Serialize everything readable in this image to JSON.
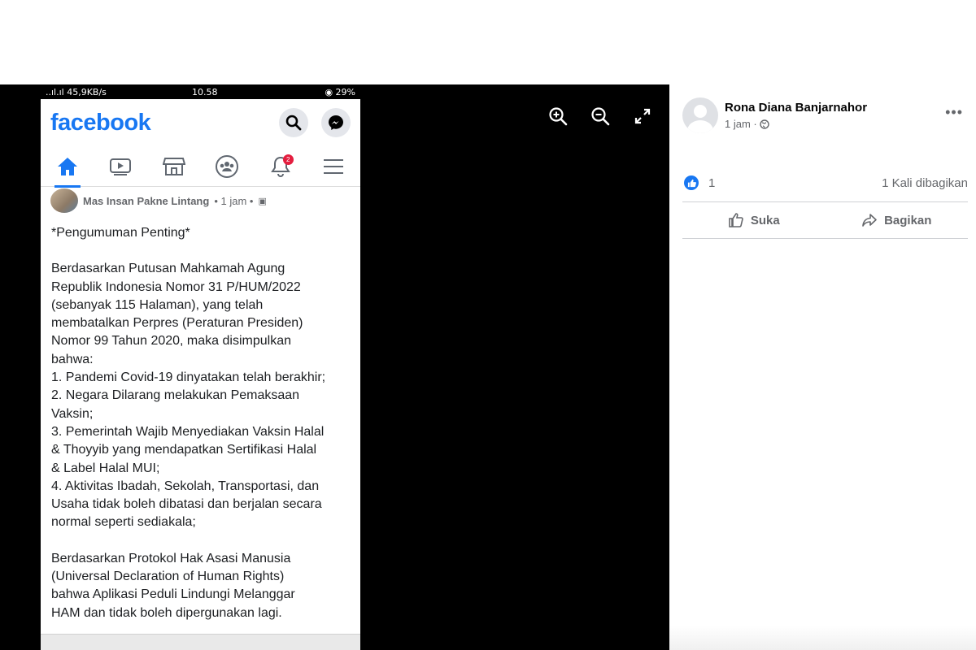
{
  "status_bar": {
    "signal": "..ıl.ıl 45,9KB/s",
    "time": "10.58",
    "battery": "29%"
  },
  "facebook_app": {
    "logo": "facebook",
    "notification_count": "2",
    "tabs": [
      "home-icon",
      "video-icon",
      "marketplace-icon",
      "groups-icon",
      "notifications-icon",
      "menu-icon"
    ]
  },
  "post": {
    "author": "Mas Insan Pakne Lintang",
    "time": "• 1 jam •",
    "lines": [
      "*Pengumuman Penting*",
      "",
      "Berdasarkan  Putusan Mahkamah Agung",
      "Republik Indonesia Nomor 31 P/HUM/2022",
      "(sebanyak 115 Halaman), yang telah",
      "membatalkan Perpres (Peraturan Presiden)",
      "Nomor 99 Tahun 2020, maka disimpulkan",
      "bahwa:",
      "1. Pandemi Covid-19 dinyatakan telah berakhir;",
      "2. Negara Dilarang melakukan Pemaksaan",
      "Vaksin;",
      "3. Pemerintah Wajib Menyediakan Vaksin Halal",
      "& Thoyyib yang mendapatkan Sertifikasi Halal",
      "& Label Halal MUI;",
      "4. Aktivitas Ibadah, Sekolah, Transportasi, dan",
      "Usaha tidak boleh dibatasi dan berjalan secara",
      "normal seperti sediakala;",
      "",
      "Berdasarkan Protokol Hak Asasi Manusia",
      "(Universal Declaration of Human Rights)",
      "bahwa Aplikasi Peduli Lindungi Melanggar",
      "HAM dan tidak boleh dipergunakan lagi."
    ]
  },
  "viewer_controls": [
    "zoom-in-icon",
    "zoom-out-icon",
    "fullscreen-icon"
  ],
  "sidebar": {
    "name": "Rona Diana Banjarnahor",
    "time": "1 jam ·",
    "more": "•••",
    "like_count": "1",
    "shares": "1 Kali dibagikan",
    "like_label": "Suka",
    "share_label": "Bagikan"
  },
  "colors": {
    "brand": "#1877f2",
    "viewer_bg": "#000000",
    "badge": "#e41e3f"
  }
}
